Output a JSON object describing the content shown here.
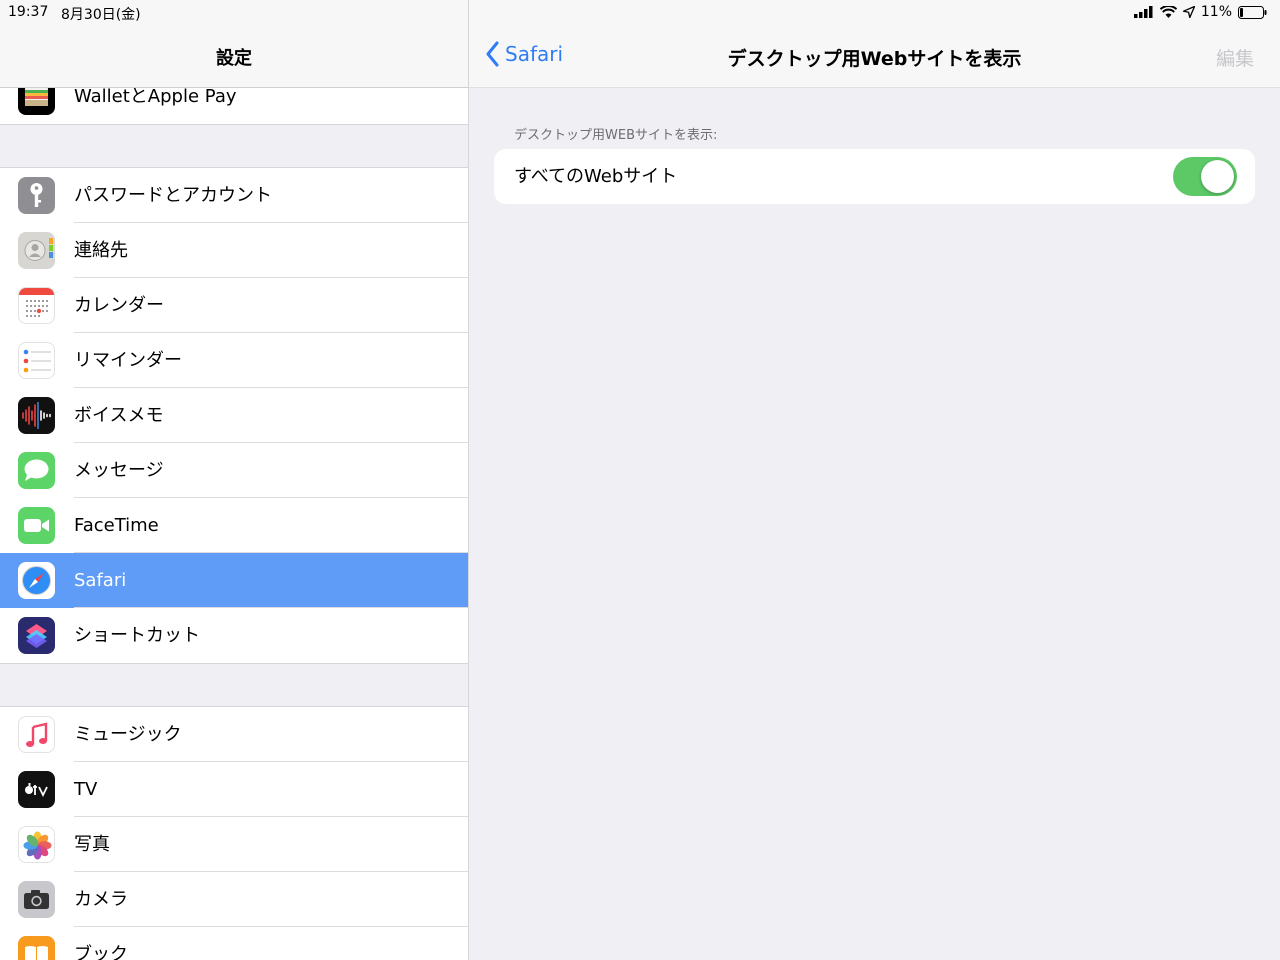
{
  "status": {
    "time": "19:37",
    "date": "8月30日(金)",
    "battery": "11%"
  },
  "sidebar": {
    "title": "設定",
    "top_item": {
      "label": "WalletとApple Pay",
      "icon": "wallet-icon"
    },
    "group1": [
      {
        "label": "パスワードとアカウント",
        "icon": "key-icon"
      },
      {
        "label": "連絡先",
        "icon": "contacts-icon"
      },
      {
        "label": "カレンダー",
        "icon": "calendar-icon"
      },
      {
        "label": "リマインダー",
        "icon": "reminders-icon"
      },
      {
        "label": "ボイスメモ",
        "icon": "voice-memos-icon"
      },
      {
        "label": "メッセージ",
        "icon": "messages-icon"
      },
      {
        "label": "FaceTime",
        "icon": "facetime-icon"
      },
      {
        "label": "Safari",
        "icon": "safari-icon",
        "selected": true
      },
      {
        "label": "ショートカット",
        "icon": "shortcuts-icon"
      }
    ],
    "group2": [
      {
        "label": "ミュージック",
        "icon": "music-icon"
      },
      {
        "label": "TV",
        "icon": "tv-icon"
      },
      {
        "label": "写真",
        "icon": "photos-icon"
      },
      {
        "label": "カメラ",
        "icon": "camera-icon"
      },
      {
        "label": "ブック",
        "icon": "books-icon"
      }
    ]
  },
  "main": {
    "back_label": "Safari",
    "title": "デスクトップ用Webサイトを表示",
    "edit_label": "編集",
    "section_header": "デスクトップ用WEBサイトを表示:",
    "setting": {
      "label": "すべてのWebサイト",
      "on": true
    }
  },
  "colors": {
    "accent": "#2f7cf6",
    "selected_row": "#5f9cf7",
    "toggle_on": "#5cc866"
  }
}
